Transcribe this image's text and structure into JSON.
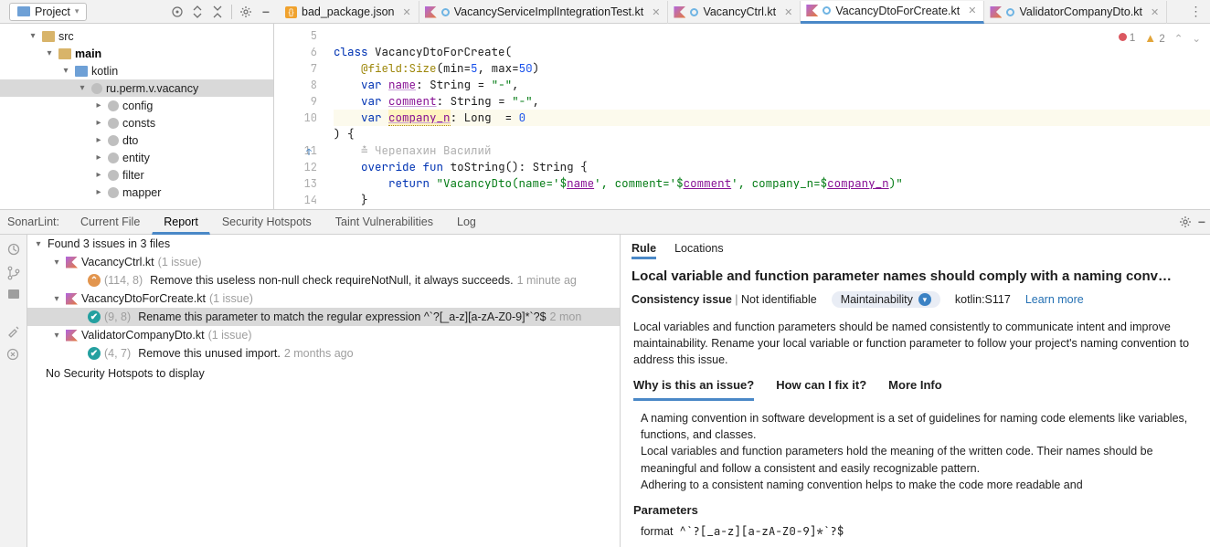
{
  "toolbar": {
    "project_label": "Project"
  },
  "tabs": [
    {
      "name": "bad_package.json",
      "type": "json",
      "active": false,
      "ring": false
    },
    {
      "name": "VacancyServiceImplIntegrationTest.kt",
      "type": "kt",
      "active": false,
      "ring": true
    },
    {
      "name": "VacancyCtrl.kt",
      "type": "kt",
      "active": false,
      "ring": true
    },
    {
      "name": "VacancyDtoForCreate.kt",
      "type": "kt",
      "active": true,
      "ring": true
    },
    {
      "name": "ValidatorCompanyDto.kt",
      "type": "kt",
      "active": false,
      "ring": true
    }
  ],
  "marks": {
    "errors": "1",
    "warnings": "2"
  },
  "tree": {
    "src": "src",
    "main": "main",
    "kotlin": "kotlin",
    "pkg": "ru.perm.v.vacancy",
    "children": [
      "config",
      "consts",
      "dto",
      "entity",
      "filter",
      "mapper"
    ]
  },
  "code": {
    "line5_a": "class",
    "line5_b": " VacancyDtoForCreate(",
    "line6_a": "@field:Size",
    "line6_b": "(min=",
    "line6_c": "5",
    "line6_d": ", max=",
    "line6_e": "50",
    "line6_f": ")",
    "line7_a": "var",
    "line7_b": "name",
    "line7_c": ": String = ",
    "line7_d": "\"-\"",
    "line7_e": ",",
    "line8_a": "var",
    "line8_b": "comment",
    "line8_c": ": String = ",
    "line8_d": "\"-\"",
    "line8_e": ",",
    "line9_a": "var",
    "line9_b": "company_n",
    "line9_c": ": Long  = ",
    "line9_d": "0",
    "line10": ") {",
    "author": "Черепахин Василий",
    "line11_a": "override",
    "line11_b": "fun",
    "line11_c": " toString(): String {",
    "line12_a": "return",
    "line12_b": "\"VacancyDto(name='",
    "line12_c": "$",
    "line12_d": "name",
    "line12_e": "', comment='",
    "line12_f": "$",
    "line12_g": "comment",
    "line12_h": "', company_n=",
    "line12_i": "$",
    "line12_j": "company_n",
    "line12_k": ")\"",
    "line13": "}",
    "line14": "}",
    "gutter": [
      "5",
      "6",
      "7",
      "8",
      "9",
      "10",
      "",
      "11",
      "12",
      "13",
      "14"
    ]
  },
  "sonar": {
    "label": "SonarLint:",
    "tabs": [
      "Current File",
      "Report",
      "Security Hotspots",
      "Taint Vulnerabilities",
      "Log"
    ],
    "active_tab": "Report",
    "summary": "Found 3 issues in 3 files",
    "files": [
      {
        "name": "VacancyCtrl.kt",
        "count": "(1 issue)",
        "issues": [
          {
            "badge": "b-orange",
            "glyph": "⌃",
            "loc": "(114, 8)",
            "msg": "Remove this useless non-null check requireNotNull, it always succeeds.",
            "ago": "1 minute ag"
          }
        ]
      },
      {
        "name": "VacancyDtoForCreate.kt",
        "count": "(1 issue)",
        "issues": [
          {
            "badge": "b-teal",
            "glyph": "✔",
            "loc": "(9, 8)",
            "msg": "Rename this parameter to match the regular expression ^`?[_a-z][a-zA-Z0-9]*`?$",
            "ago": "2 mon",
            "sel": true
          }
        ]
      },
      {
        "name": "ValidatorCompanyDto.kt",
        "count": "(1 issue)",
        "issues": [
          {
            "badge": "b-teal",
            "glyph": "✔",
            "loc": "(4, 7)",
            "msg": "Remove this unused import.",
            "ago": "2 months ago"
          }
        ]
      }
    ],
    "hotspots": "No Security Hotspots to display"
  },
  "rule": {
    "tabs": [
      "Rule",
      "Locations"
    ],
    "active_tab": "Rule",
    "title": "Local variable and function parameter names should comply with a naming conv…",
    "consistency": "Consistency issue",
    "identifiable": "Not identifiable",
    "maintainability": "Maintainability",
    "rule_id": "kotlin:S117",
    "learn_more": "Learn more",
    "description": "Local variables and function parameters should be named consistently to communicate intent and improve maintainability. Rename your local variable or function parameter to follow your project's naming convention to address this issue.",
    "inner_tabs": [
      "Why is this an issue?",
      "How can I fix it?",
      "More Info"
    ],
    "inner_active": "Why is this an issue?",
    "body1": "A naming convention in software development is a set of guidelines for naming code elements like variables, functions, and classes.",
    "body2": "Local variables and function parameters hold the meaning of the written code. Their names should be meaningful and follow a consistent and easily recognizable pattern.",
    "body3": "Adhering to a consistent naming convention helps to make the code more readable and",
    "params_title": "Parameters",
    "param_label": "format",
    "param_value": "^`?[_a-z][a-zA-Z0-9]*`?$"
  }
}
